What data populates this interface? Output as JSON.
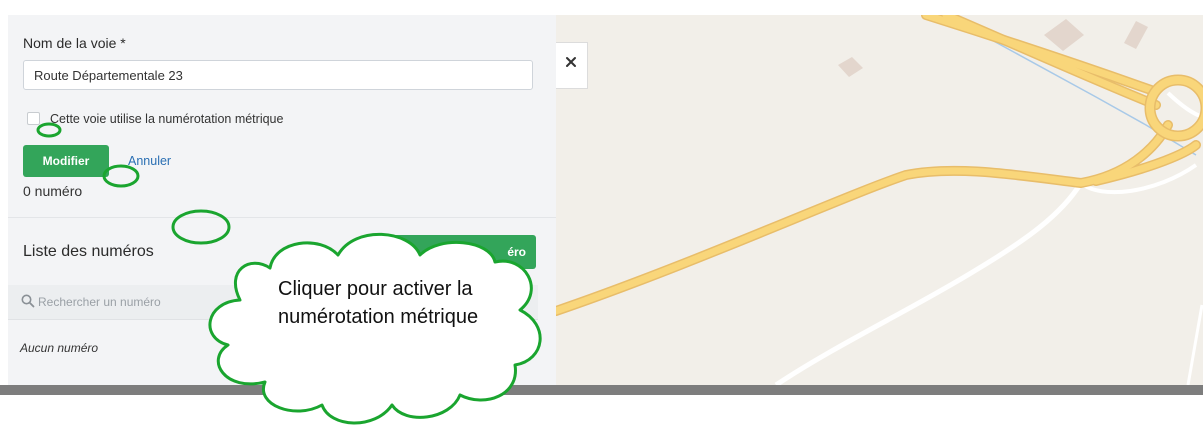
{
  "form": {
    "field_label": "Nom de la voie *",
    "street_name": "Route Départementale 23",
    "metric_checkbox_label": "Cette voie utilise la numérotation métrique",
    "metric_checked": false,
    "modify_label": "Modifier",
    "cancel_label": "Annuler",
    "count_text": "0 numéro"
  },
  "numbers_list": {
    "heading": "Liste des numéros",
    "add_button_visible_text": "éro",
    "search_placeholder": "Rechercher un numéro",
    "empty_text": "Aucun numéro"
  },
  "map": {
    "close_icon": "close-icon"
  },
  "annotation": {
    "callout_text": "Cliquer pour activer la numérotation métrique",
    "color": "#1aa52f"
  },
  "colors": {
    "accent_green": "#33a55a",
    "link_blue": "#2a6fb3",
    "road_yellow": "#f9d67a",
    "map_bg": "#f2efe9"
  }
}
